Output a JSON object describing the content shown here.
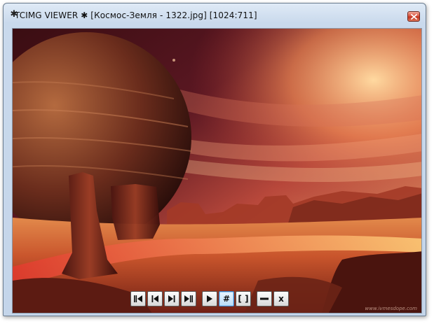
{
  "window": {
    "title": "TCIMG VIEWER ✱ [Космос-Земля - 1322.jpg] [1024:711]",
    "icon": "✱"
  },
  "titlebar_buttons": {
    "close": "close-icon"
  },
  "image": {
    "description_icon": "space-landscape-image",
    "watermark": "www.ivmesdope.com"
  },
  "toolbar": {
    "buttons": [
      {
        "name": "first",
        "icon": "first-icon"
      },
      {
        "name": "previous",
        "icon": "previous-icon"
      },
      {
        "name": "next",
        "icon": "next-icon"
      },
      {
        "name": "last",
        "icon": "last-icon"
      },
      {
        "name": "slideshow",
        "icon": "play-icon"
      },
      {
        "name": "grid",
        "label": "#"
      },
      {
        "name": "fit",
        "label": "[ ]"
      },
      {
        "name": "minimize",
        "icon": "minimize-icon"
      },
      {
        "name": "close",
        "label": "x"
      }
    ]
  }
}
